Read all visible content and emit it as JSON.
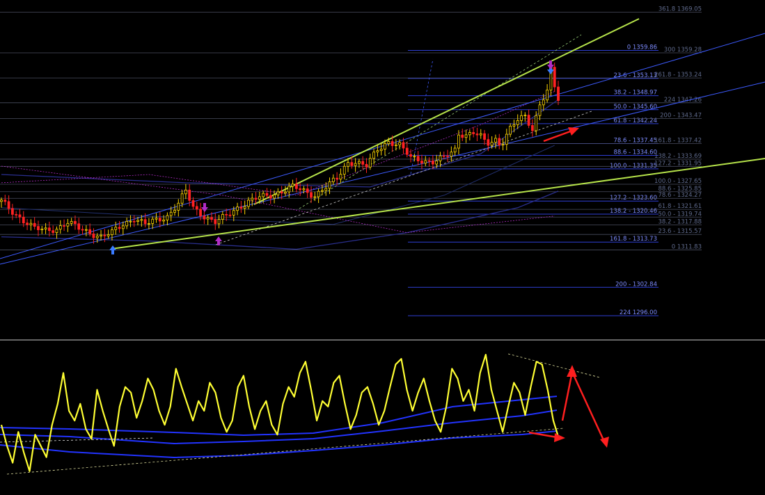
{
  "chart_data": [
    {
      "type": "candlestick",
      "panel": "price",
      "colors": {
        "background": "#000000",
        "candle_up": "#ffd700",
        "candle_down": "#ff2222",
        "trendline": "#b6e34a",
        "channel_line": "#3d5bff",
        "fib_line": "#2f3fd6",
        "fib_text_primary": "#7d8cff",
        "fib_text_secondary": "#5f6a8c",
        "band": "#2a2f8f",
        "band_dashed": "#b02cc6",
        "arrow": "#ff1f1f"
      },
      "ylim": [
        1290,
        1372
      ],
      "x_range": [
        0,
        130
      ],
      "close_path": [
        [
          0,
          1323.5
        ],
        [
          3,
          1321
        ],
        [
          6,
          1319
        ],
        [
          9,
          1317
        ],
        [
          12,
          1316.5
        ],
        [
          15,
          1317
        ],
        [
          18,
          1318.5
        ],
        [
          21,
          1317
        ],
        [
          24,
          1316
        ],
        [
          27,
          1315
        ],
        [
          30,
          1316
        ],
        [
          33,
          1318
        ],
        [
          36,
          1319.5
        ],
        [
          39,
          1318
        ],
        [
          42,
          1319
        ],
        [
          45,
          1320
        ],
        [
          48,
          1323
        ],
        [
          50,
          1326
        ],
        [
          52,
          1322
        ],
        [
          55,
          1320
        ],
        [
          58,
          1318.5
        ],
        [
          61,
          1320
        ],
        [
          64,
          1322
        ],
        [
          67,
          1323.5
        ],
        [
          70,
          1324.5
        ],
        [
          73,
          1325
        ],
        [
          76,
          1326
        ],
        [
          79,
          1327
        ],
        [
          82,
          1326
        ],
        [
          85,
          1325
        ],
        [
          88,
          1327
        ],
        [
          91,
          1329
        ],
        [
          94,
          1333
        ],
        [
          96,
          1333
        ],
        [
          99,
          1332
        ],
        [
          102,
          1336
        ],
        [
          105,
          1338
        ],
        [
          108,
          1337
        ],
        [
          111,
          1334
        ],
        [
          114,
          1333.5
        ],
        [
          117,
          1333
        ],
        [
          120,
          1334
        ],
        [
          123,
          1336
        ],
        [
          124,
          1340
        ],
        [
          126,
          1339.5
        ],
        [
          128,
          1340
        ],
        [
          130,
          1339
        ],
        [
          131,
          1338
        ],
        [
          132,
          1337.5
        ],
        [
          133,
          1338
        ],
        [
          134,
          1338.5
        ],
        [
          135,
          1337.5
        ],
        [
          136,
          1338
        ],
        [
          138,
          1341
        ],
        [
          140,
          1343
        ],
        [
          142,
          1344
        ],
        [
          144,
          1341
        ],
        [
          146,
          1347
        ],
        [
          148,
          1350
        ],
        [
          149,
          1355
        ],
        [
          150,
          1351
        ],
        [
          151,
          1348
        ]
      ],
      "fib_levels_primary": [
        {
          "ratio": "0",
          "price": "1359.86"
        },
        {
          "ratio": "23.6",
          "price": "1353.13"
        },
        {
          "ratio": "38.2",
          "price": "1348.97"
        },
        {
          "ratio": "50.0",
          "price": "1345.60"
        },
        {
          "ratio": "61.8",
          "price": "1342.24"
        },
        {
          "ratio": "78.6",
          "price": "1337.45"
        },
        {
          "ratio": "88.6",
          "price": "1334.60"
        },
        {
          "ratio": "100.0",
          "price": "1331.35"
        },
        {
          "ratio": "127.2",
          "price": "1323.60"
        },
        {
          "ratio": "138.2",
          "price": "1320.46"
        },
        {
          "ratio": "161.8",
          "price": "1313.73"
        },
        {
          "ratio": "200",
          "price": "1302.84"
        },
        {
          "ratio": "224",
          "price": "1296.00"
        }
      ],
      "fib_levels_secondary": [
        {
          "ratio": "361.8",
          "price": "1369.05"
        },
        {
          "ratio": "300",
          "price": "1359.28"
        },
        {
          "ratio": "261.8",
          "price": "1353.24"
        },
        {
          "ratio": "224",
          "price": "1347.26"
        },
        {
          "ratio": "200",
          "price": "1343.47"
        },
        {
          "ratio": "161.8",
          "price": "1337.42"
        },
        {
          "ratio": "138.2",
          "price": "1333.69"
        },
        {
          "ratio": "127.2",
          "price": "1331.95"
        },
        {
          "ratio": "100.0",
          "price": "1327.65"
        },
        {
          "ratio": "88.6",
          "price": "1325.85"
        },
        {
          "ratio": "78.6",
          "price": "1324.27"
        },
        {
          "ratio": "61.8",
          "price": "1321.61"
        },
        {
          "ratio": "50.0",
          "price": "1319.74"
        },
        {
          "ratio": "38.2",
          "price": "1317.88"
        },
        {
          "ratio": "23.6",
          "price": "1315.57"
        },
        {
          "ratio": "0",
          "price": "1311.83"
        }
      ]
    },
    {
      "type": "line",
      "panel": "oscillator",
      "ylim": [
        0,
        100
      ],
      "series": [
        {
          "color": "#ffff33",
          "values": [
            45,
            30,
            18,
            40,
            25,
            12,
            38,
            30,
            22,
            45,
            60,
            82,
            55,
            48,
            60,
            42,
            35,
            70,
            55,
            42,
            30,
            58,
            72,
            68,
            50,
            62,
            78,
            70,
            55,
            45,
            58,
            85,
            72,
            60,
            48,
            62,
            55,
            75,
            68,
            50,
            40,
            48,
            72,
            80,
            58,
            42,
            55,
            62,
            45,
            38,
            60,
            72,
            65,
            82,
            90,
            70,
            48,
            62,
            58,
            75,
            80,
            60,
            42,
            52,
            68,
            72,
            60,
            45,
            55,
            72,
            88,
            92,
            70,
            55,
            68,
            78,
            62,
            48,
            40,
            58,
            85,
            78,
            62,
            70,
            55,
            82,
            95,
            70,
            55,
            40,
            58,
            75,
            68,
            52,
            72,
            90,
            88,
            70,
            48,
            35
          ]
        }
      ]
    }
  ]
}
